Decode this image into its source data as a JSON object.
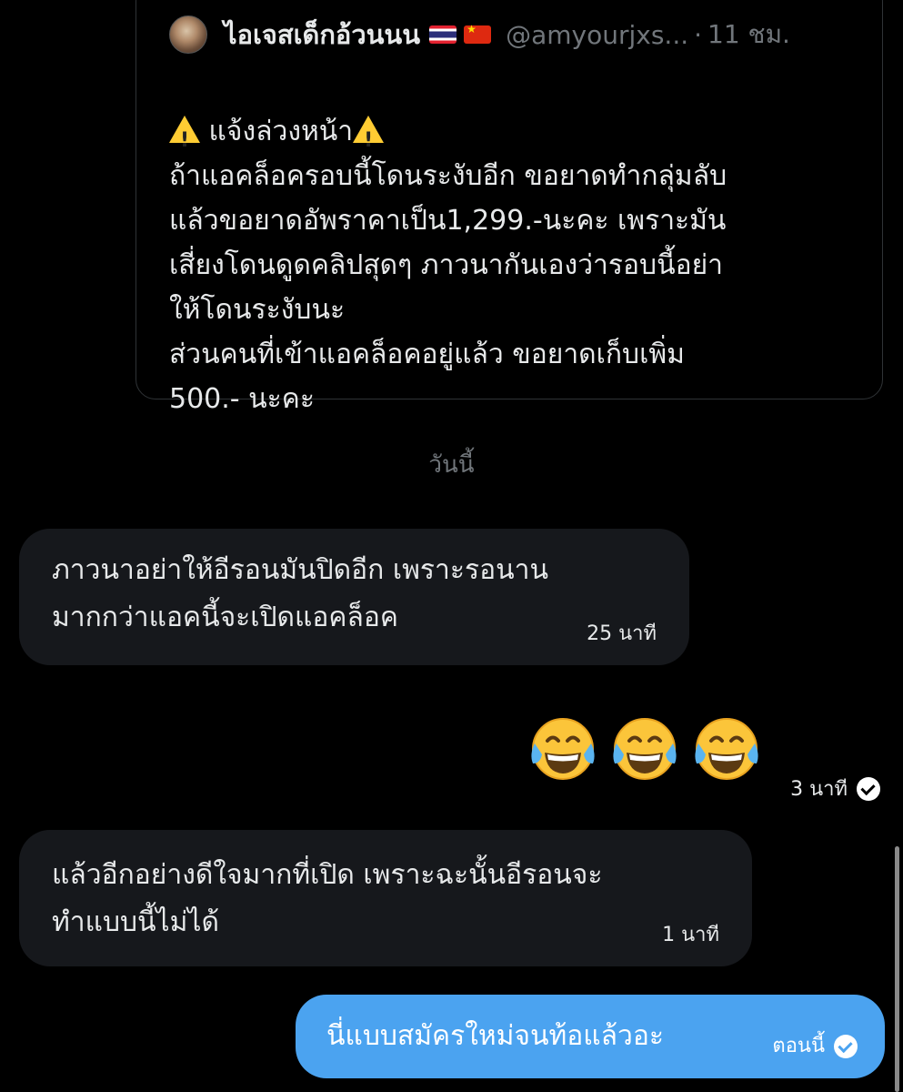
{
  "quoted_tweet": {
    "display_name": "ไอเจสเด็กอ้วนนน",
    "flags": [
      "thailand-flag",
      "china-flag"
    ],
    "handle": "@amyourjxs...",
    "separator": "·",
    "time": "11 ชม.",
    "heading": "แจ้งล่วงหน้า",
    "body": "ถ้าแอคล็อครอบนี้โดนระงับอีก ขอยาดทำกลุ่มลับ\nแล้วขอยาดอัพราคาเป็น1,299.-นะคะ เพราะมัน\nเสี่ยงโดนดูดคลิปสุดๆ ภาวนากันเองว่ารอบนี้อย่า\nให้โดนระงับนะ\nส่วนคนที่เข้าแอคล็อคอยู่แล้ว ขอยาดเก็บเพิ่ม\n500.- นะคะ"
  },
  "date_divider": "วันนี้",
  "messages": [
    {
      "direction": "incoming",
      "text": "ภาวนาอย่าให้อีรอนมันปิดอีก เพราะรอนาน\nมากกว่าแอคนี้จะเปิดแอคล็อค",
      "time": "25 นาที"
    },
    {
      "direction": "outgoing",
      "emojis": [
        "face-with-tears-of-joy",
        "face-with-tears-of-joy",
        "face-with-tears-of-joy"
      ],
      "time": "3 นาที",
      "status_icon": "sent-check-icon"
    },
    {
      "direction": "incoming",
      "text": "แล้วอีกอย่างดีใจมากที่เปิด เพราะฉะนั้นอีรอนจะ\nทำแบบนี้ไม่ได้",
      "time": "1 นาที"
    },
    {
      "direction": "outgoing",
      "text": "นี่แบบสมัครใหม่จนท้อแล้วอะ",
      "time": "ตอนนี้",
      "status_icon": "sent-check-icon"
    }
  ],
  "colors": {
    "background": "#000000",
    "incoming_bubble": "#16181c",
    "outgoing_bubble": "#4ba3f0",
    "muted_text": "#71767b",
    "card_border": "#2f3336"
  }
}
